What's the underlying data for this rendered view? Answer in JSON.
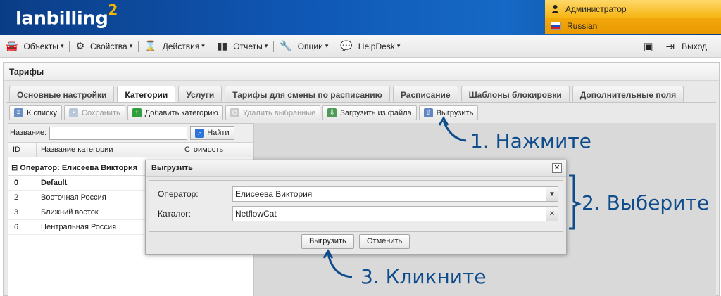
{
  "header": {
    "logo": "lanbilling",
    "logo_sup": "2",
    "user": "Администратор",
    "language": "Russian"
  },
  "menu": {
    "items": [
      {
        "label": "Объекты",
        "icon": "car-icon"
      },
      {
        "label": "Свойства",
        "icon": "gear-icon"
      },
      {
        "label": "Действия",
        "icon": "hourglass-icon"
      },
      {
        "label": "Отчеты",
        "icon": "bar-chart-icon"
      },
      {
        "label": "Опции",
        "icon": "wrench-icon"
      },
      {
        "label": "HelpDesk",
        "icon": "speech-bubble-icon"
      }
    ],
    "logout": "Выход"
  },
  "panel": {
    "title": "Тарифы",
    "tabs": [
      "Основные настройки",
      "Категории",
      "Услуги",
      "Тарифы для смены по расписанию",
      "Расписание",
      "Шаблоны блокировки",
      "Дополнительные поля"
    ],
    "active_tab": "Категории"
  },
  "toolbar": {
    "to_list": "К списку",
    "save": "Сохранить",
    "add": "Добавить категорию",
    "delete": "Удалить выбранные",
    "load": "Загрузить из файла",
    "export": "Выгрузить"
  },
  "grid": {
    "search_label": "Название:",
    "find_button": "Найти",
    "columns": [
      "ID",
      "Название категории",
      "Стоимость"
    ],
    "group": "Оператор: Елисеева Виктория",
    "rows": [
      {
        "id": "0",
        "name": "Default"
      },
      {
        "id": "2",
        "name": "Восточная Россия"
      },
      {
        "id": "3",
        "name": "Ближний восток"
      },
      {
        "id": "6",
        "name": "Центральная Россия"
      }
    ]
  },
  "modal": {
    "title": "Выгрузить",
    "operator_label": "Оператор:",
    "operator_value": "Елисеева Виктория",
    "catalog_label": "Каталог:",
    "catalog_value": "NetflowCat",
    "ok": "Выгрузить",
    "cancel": "Отменить"
  },
  "annotations": {
    "step1": "1. Нажмите",
    "step2": "2. Выберите",
    "step3": "3. Кликните",
    "color": "#0e4c8c"
  }
}
